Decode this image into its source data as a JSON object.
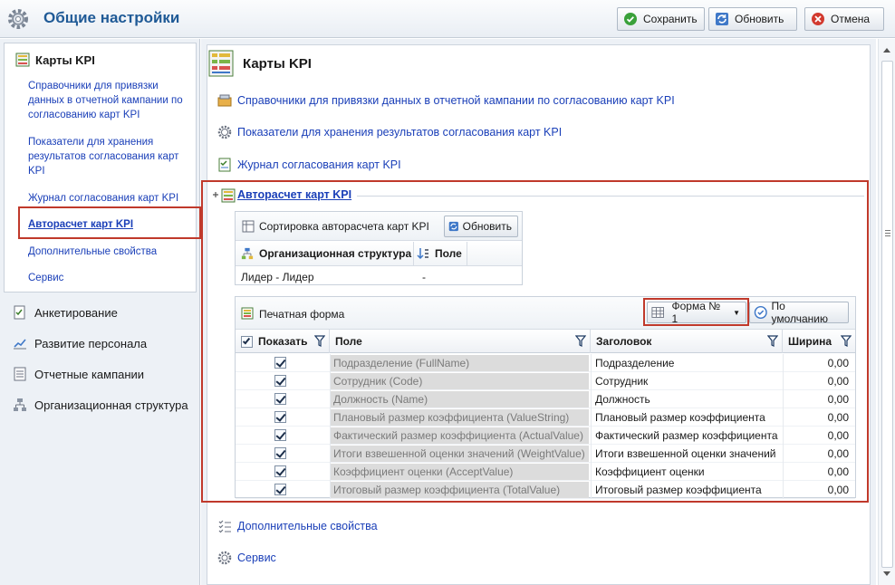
{
  "window": {
    "title": "Общие настройки",
    "buttons": {
      "save": "Сохранить",
      "refresh": "Обновить",
      "cancel": "Отмена"
    }
  },
  "sidebar": {
    "section_title": "Карты KPI",
    "links": [
      "Справочники для привязки данных в отчетной кампании по согласованию карт KPI",
      "Показатели для хранения результатов согласования карт KPI",
      "Журнал согласования карт KPI",
      "Авторасчет карт KPI",
      "Дополнительные свойства",
      "Сервис"
    ],
    "nav": [
      "Анкетирование",
      "Развитие персонала",
      "Отчетные кампании",
      "Организационная структура"
    ]
  },
  "main": {
    "title": "Карты KPI",
    "links": [
      "Справочники для привязки данных в отчетной кампании по согласованию карт KPI",
      "Показатели для хранения результатов согласования карт KPI",
      "Журнал согласования карт KPI"
    ],
    "section_title": "Авторасчет карт KPI",
    "sort": {
      "title": "Сортировка авторасчета карт KPI",
      "refresh": "Обновить",
      "col_org": "Организационная структура",
      "col_field": "Поле",
      "row_org": "Лидер - Лидер",
      "row_field": "-"
    },
    "print": {
      "title": "Печатная форма",
      "form_select": "Форма № 1",
      "default_btn": "По умолчанию",
      "headers": {
        "show": "Показать",
        "field": "Поле",
        "caption": "Заголовок",
        "width": "Ширина"
      },
      "rows": [
        {
          "field": "Подразделение (FullName)",
          "caption": "Подразделение",
          "width": "0,00"
        },
        {
          "field": "Сотрудник (Code)",
          "caption": "Сотрудник",
          "width": "0,00"
        },
        {
          "field": "Должность (Name)",
          "caption": "Должность",
          "width": "0,00"
        },
        {
          "field": "Плановый размер коэффициента (ValueString)",
          "caption": "Плановый размер коэффициента",
          "width": "0,00"
        },
        {
          "field": "Фактический размер коэффициента (ActualValue)",
          "caption": "Фактический размер коэффициента",
          "width": "0,00"
        },
        {
          "field": "Итоги взвешенной оценки значений (WeightValue)",
          "caption": "Итоги взвешенной оценки значений",
          "width": "0,00"
        },
        {
          "field": "Коэффициент оценки (AcceptValue)",
          "caption": "Коэффициент оценки",
          "width": "0,00"
        },
        {
          "field": "Итоговый размер коэффициента (TotalValue)",
          "caption": "Итоговый размер коэффициента",
          "width": "0,00"
        }
      ]
    },
    "extra_links": [
      "Дополнительные свойства",
      "Сервис"
    ]
  },
  "colors": {
    "link": "#1a3fb8",
    "highlight": "#c0392b",
    "title": "#1f5a96"
  }
}
